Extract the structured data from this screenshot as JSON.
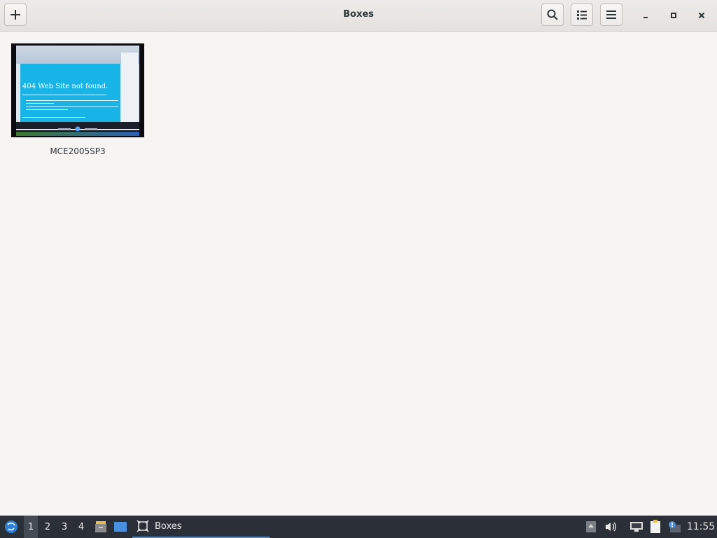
{
  "window": {
    "title": "Boxes"
  },
  "headerbar": {
    "new_button_icon": "plus-icon",
    "search_icon": "search-icon",
    "view_icon": "list-view-icon",
    "menu_icon": "hamburger-menu-icon",
    "minimize_icon": "minimize-icon",
    "maximize_icon": "maximize-icon",
    "close_icon": "close-icon"
  },
  "boxes": [
    {
      "name": "MCE2005SP3",
      "thumbnail_text": "404 Web Site not found."
    }
  ],
  "taskbar": {
    "workspaces": [
      "1",
      "2",
      "3",
      "4"
    ],
    "active_workspace": "1",
    "active_task": "Boxes",
    "clock": "11:55"
  },
  "colors": {
    "headerbar_bg": "#e8e6e3",
    "content_bg": "#f6f5f4",
    "taskbar_bg": "#2b3038",
    "accent": "#3f8fe4"
  }
}
